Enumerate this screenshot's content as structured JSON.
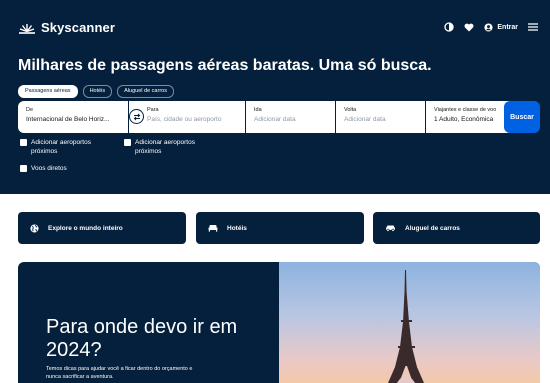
{
  "brand": {
    "name": "Skyscanner"
  },
  "header": {
    "login_label": "Entrar"
  },
  "hero": {
    "title": "Milhares de passagens aéreas baratas. Uma só busca."
  },
  "tabs": [
    {
      "label": "Passagens aéreas",
      "active": true
    },
    {
      "label": "Hotéis",
      "active": false
    },
    {
      "label": "Aluguel de carros",
      "active": false
    }
  ],
  "search": {
    "from": {
      "label": "De",
      "value": "Internacional de Belo Horiz..."
    },
    "to": {
      "label": "Para",
      "placeholder": "País, cidade ou aeroporto"
    },
    "depart": {
      "label": "Ida",
      "placeholder": "Adicionar data"
    },
    "return": {
      "label": "Volta",
      "placeholder": "Adicionar data"
    },
    "travelers": {
      "label": "Viajantes e classe de voo",
      "value": "1 Adulto, Econômica"
    },
    "button": "Buscar"
  },
  "options": {
    "nearby_from": "Adicionar aeroportos próximos",
    "nearby_to": "Adicionar aeroportos próximos",
    "direct": "Voos diretos"
  },
  "quicklinks": [
    {
      "label": "Explore o mundo inteiro",
      "icon": "globe-icon"
    },
    {
      "label": "Hotéis",
      "icon": "bed-icon"
    },
    {
      "label": "Aluguel de carros",
      "icon": "car-icon"
    }
  ],
  "banner": {
    "title": "Para onde devo ir em 2024?",
    "subtitle": "Temos dicas para ajudar você a ficar dentro do orçamento e nunca sacrificar a aventura."
  },
  "colors": {
    "navy": "#05203c",
    "blue": "#0062e3",
    "white": "#ffffff"
  }
}
